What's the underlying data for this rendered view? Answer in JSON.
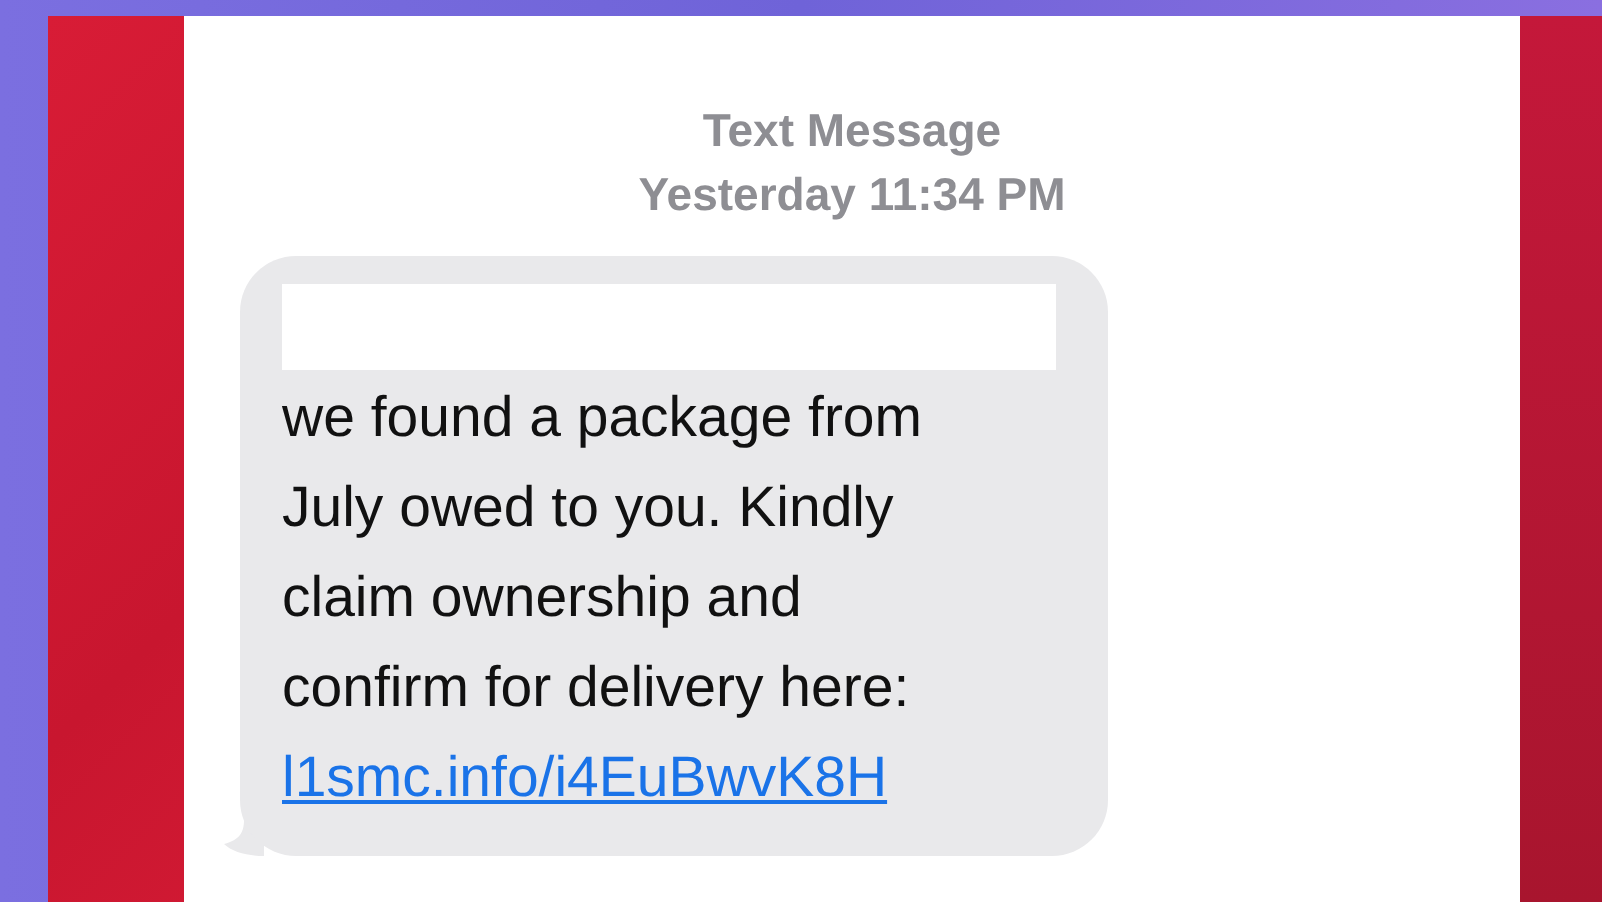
{
  "header": {
    "title": "Text Message",
    "timestamp": "Yesterday 11:34 PM"
  },
  "message": {
    "lines": [
      "we found a package from",
      "July owed to you. Kindly",
      "claim ownership and",
      "confirm for delivery here:"
    ],
    "link": "l1smc.info/i4EuBwvK8H"
  }
}
